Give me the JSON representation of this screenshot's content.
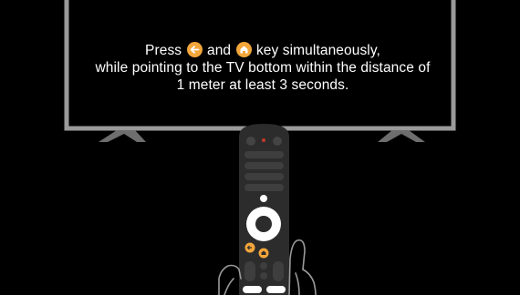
{
  "instruction": {
    "line1_before": "Press ",
    "line1_middle": " and ",
    "line1_after": " key simultaneously,",
    "line2": "while pointing to the TV bottom within the distance of",
    "line3": "1 meter at least 3 seconds."
  },
  "keys": {
    "back_icon": "back-arrow-icon",
    "home_icon": "home-icon"
  },
  "colors": {
    "background": "#000000",
    "tv_frame": "#9a9a9a",
    "key_highlight": "#f2a63a",
    "remote_body": "#2c2c2c",
    "hand_outline": "#9a9a9a",
    "text": "#ffffff"
  }
}
